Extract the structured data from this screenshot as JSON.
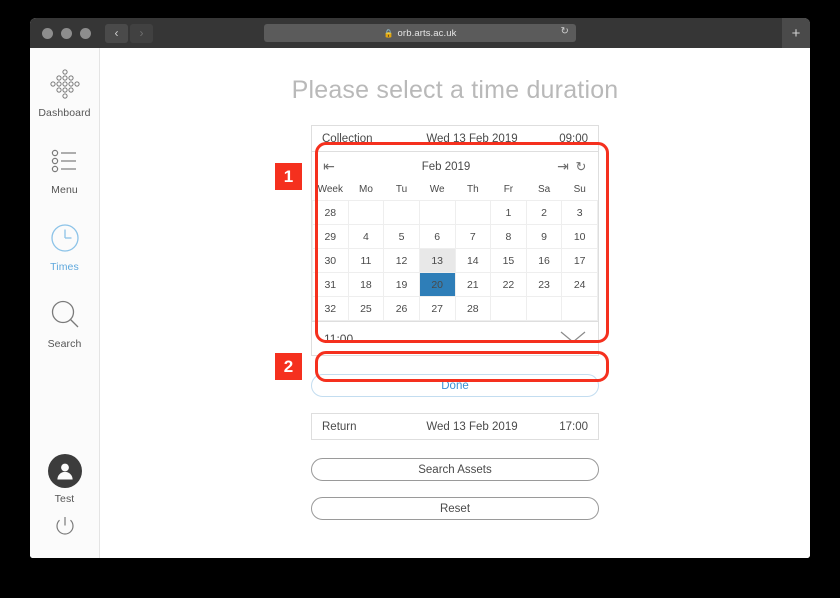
{
  "browser": {
    "url": "orb.arts.ac.uk",
    "lock_icon": "lock-icon",
    "reload_icon": "reload-icon",
    "back_icon": "chevron-left-icon",
    "forward_icon": "chevron-right-icon",
    "new_tab_label": "+"
  },
  "sidebar": {
    "items": [
      {
        "label": "Dashboard",
        "icon": "dashboard-diamond-icon",
        "active": false
      },
      {
        "label": "Menu",
        "icon": "list-menu-icon",
        "active": false
      },
      {
        "label": "Times",
        "icon": "clock-icon",
        "active": true
      },
      {
        "label": "Search",
        "icon": "magnifier-icon",
        "active": false
      }
    ],
    "user": {
      "label": "Test",
      "avatar_icon": "person-avatar-icon",
      "power_icon": "power-icon"
    },
    "active_color": "#5fa8dd"
  },
  "main": {
    "title": "Please select a time duration",
    "collection": {
      "label": "Collection",
      "date": "Wed 13 Feb 2019",
      "time": "09:00"
    },
    "return": {
      "label": "Return",
      "date": "Wed 13 Feb 2019",
      "time": "17:00"
    },
    "calendar": {
      "month_label": "Feb 2019",
      "prev_icon": "skip-previous-icon",
      "next_icon": "skip-next-icon",
      "refresh_icon": "refresh-icon",
      "headers": [
        "Week",
        "Mo",
        "Tu",
        "We",
        "Th",
        "Fr",
        "Sa",
        "Su"
      ],
      "selected_day": 20,
      "today_day": 13,
      "selected_color": "#2e7eb8",
      "today_color": "#e8e8e8",
      "weeks": [
        {
          "week": "28",
          "days": [
            "",
            "",
            "",
            "",
            "1",
            "2",
            "3"
          ]
        },
        {
          "week": "29",
          "days": [
            "4",
            "5",
            "6",
            "7",
            "8",
            "9",
            "10"
          ]
        },
        {
          "week": "30",
          "days": [
            "11",
            "12",
            "13",
            "14",
            "15",
            "16",
            "17"
          ]
        },
        {
          "week": "31",
          "days": [
            "18",
            "19",
            "20",
            "21",
            "22",
            "23",
            "24"
          ]
        },
        {
          "week": "32",
          "days": [
            "25",
            "26",
            "27",
            "28",
            "",
            "",
            ""
          ]
        }
      ]
    },
    "time_select": {
      "value": "11:00",
      "chevron_icon": "chevron-down-icon"
    },
    "done_button": "Done",
    "search_assets_button": "Search Assets",
    "reset_button": "Reset"
  },
  "annotations": {
    "color": "#f5301e",
    "badges": [
      {
        "number": "1",
        "target": "calendar-and-time-picker"
      },
      {
        "number": "2",
        "target": "done-button"
      }
    ]
  }
}
